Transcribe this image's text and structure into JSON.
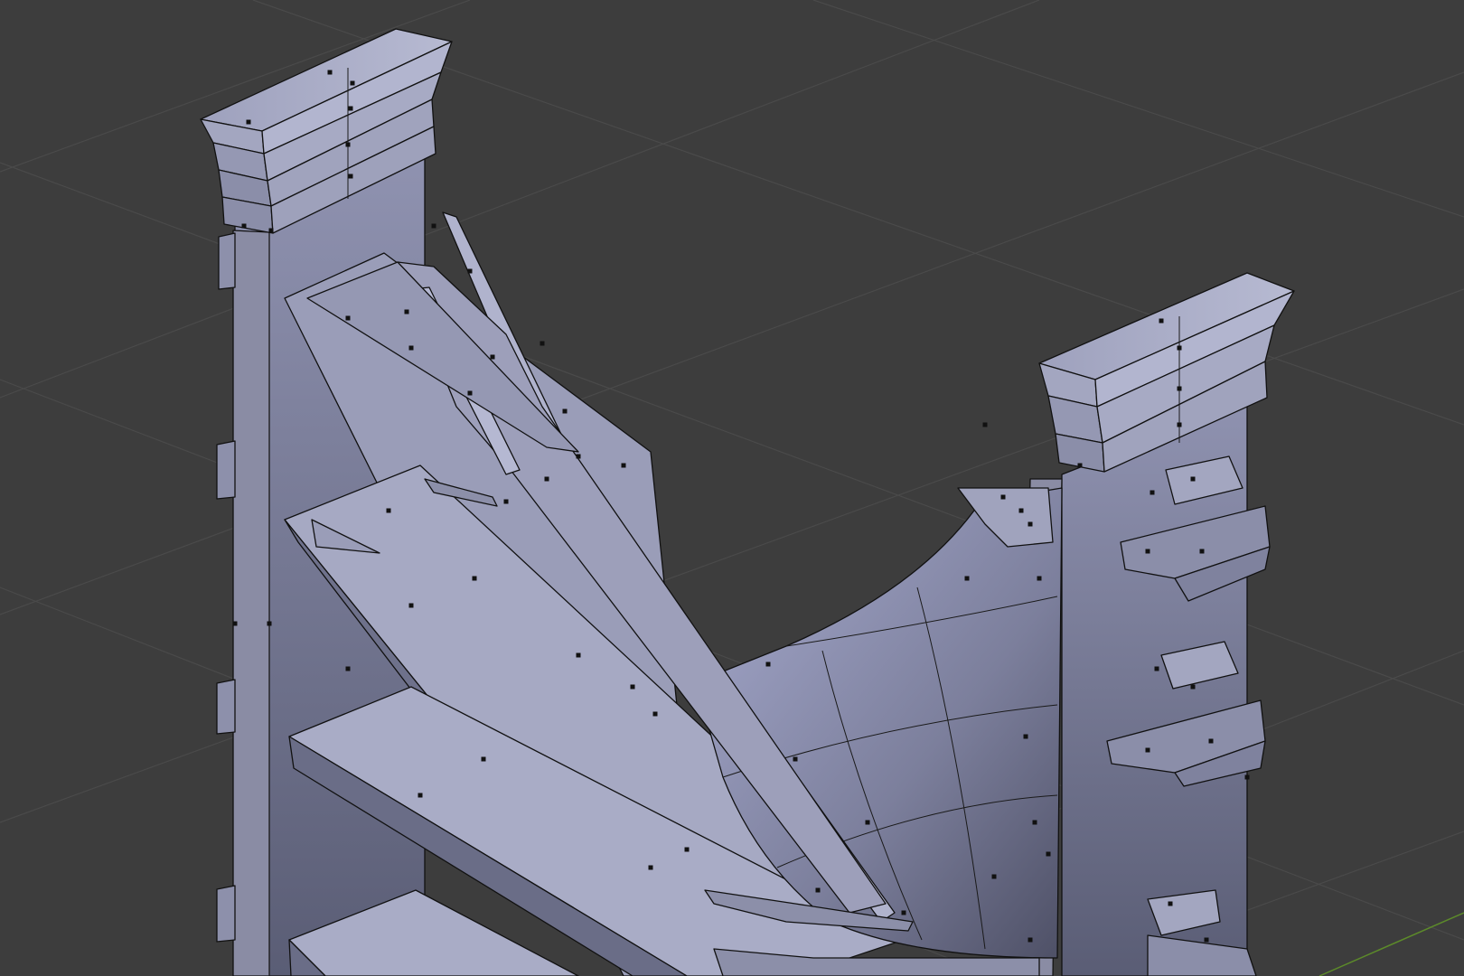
{
  "viewport": {
    "mode": "edit-mode",
    "shading": "solid",
    "background_color": "#3d3d3d",
    "grid_color": "#4a4a4a",
    "x_axis_color": "#5c8a2a",
    "mesh_light": "#a9acc6",
    "mesh_mid": "#8d90ab",
    "mesh_dark": "#5f6278",
    "mesh_shadow": "#4c4e62",
    "edge_color": "#111111",
    "vertex_color": "#111111"
  }
}
